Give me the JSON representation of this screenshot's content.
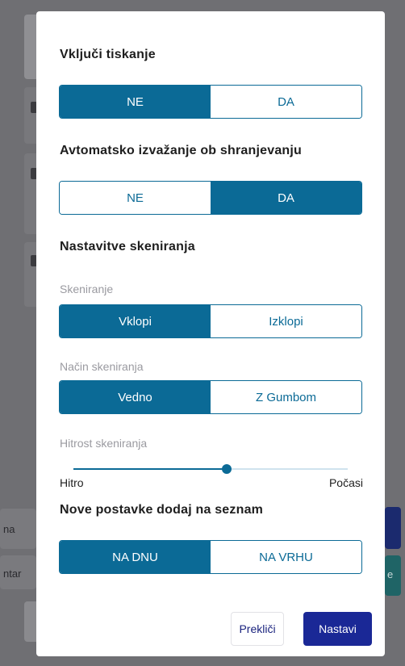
{
  "background": {
    "left_fragment_1": "na",
    "left_fragment_2": "ntar",
    "right_fragment": "e"
  },
  "dialog": {
    "print": {
      "heading": "Vključi tiskanje",
      "options": [
        "NE",
        "DA"
      ],
      "selected": "NE"
    },
    "auto_export": {
      "heading": "Avtomatsko izvažanje ob shranjevanju",
      "options": [
        "NE",
        "DA"
      ],
      "selected": "DA"
    },
    "scan_settings": {
      "heading": "Nastavitve skeniranja",
      "scanning": {
        "label": "Skeniranje",
        "options": [
          "Vklopi",
          "Izklopi"
        ],
        "selected": "Vklopi"
      },
      "scan_mode": {
        "label": "Način skeniranja",
        "options": [
          "Vedno",
          "Z Gumbom"
        ],
        "selected": "Vedno"
      },
      "scan_speed": {
        "label": "Hitrost skeniranja",
        "min_label": "Hitro",
        "max_label": "Počasi",
        "value_fraction": 0.56
      }
    },
    "new_items": {
      "heading": "Nove postavke dodaj na seznam",
      "options": [
        "NA DNU",
        "NA VRHU"
      ],
      "selected": "NA DNU"
    },
    "cancel_label": "Prekliči",
    "next_label": "Nastavi"
  },
  "colors": {
    "primary": "#0b6a96",
    "action": "#1a2896",
    "overlay": "#6f6f73"
  }
}
